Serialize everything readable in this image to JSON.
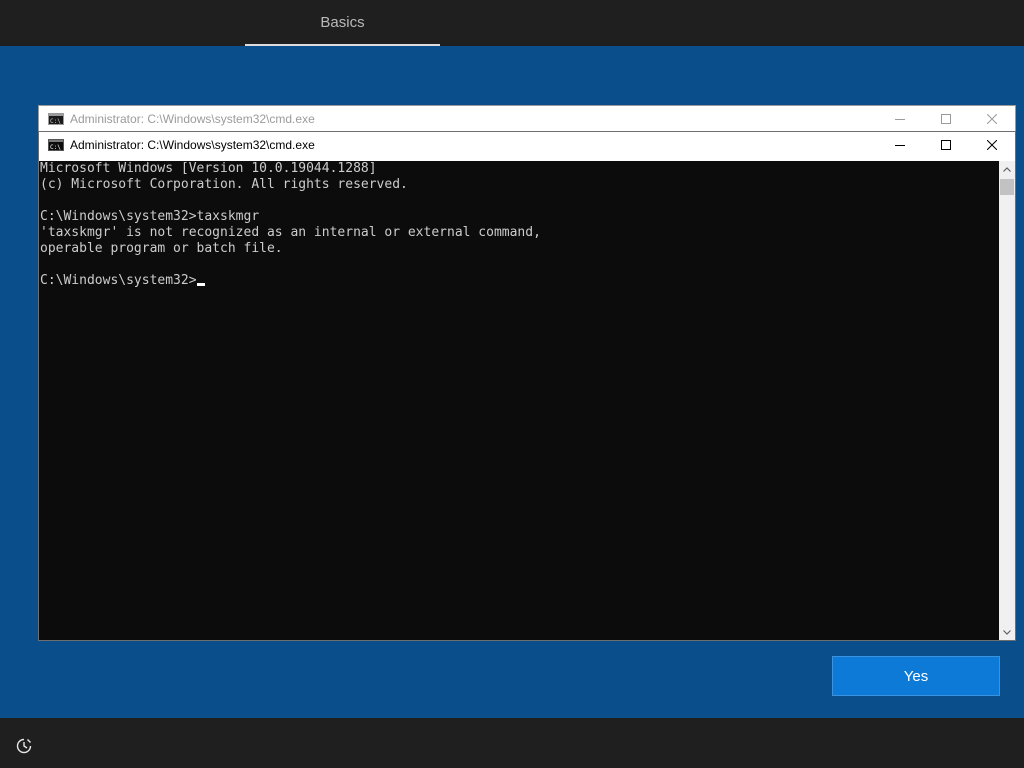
{
  "oobe": {
    "step_tab": "Basics",
    "yes_label": "Yes"
  },
  "background_window": {
    "title": "Administrator: C:\\Windows\\system32\\cmd.exe"
  },
  "console_window": {
    "title": "Administrator: C:\\Windows\\system32\\cmd.exe",
    "lines": [
      "Microsoft Windows [Version 10.0.19044.1288]",
      "(c) Microsoft Corporation. All rights reserved.",
      "",
      "C:\\Windows\\system32>taxskmgr",
      "'taxskmgr' is not recognized as an internal or external command,",
      "operable program or batch file.",
      "",
      "C:\\Windows\\system32>"
    ]
  },
  "icons": {
    "window_icon": "console-icon",
    "minimize": "minimize-icon",
    "maximize": "maximize-icon",
    "close": "close-icon",
    "accessibility": "accessibility-icon"
  },
  "colors": {
    "desktop_bg": "#0a4e8c",
    "bar_bg": "#1f1f1f",
    "accent_button": "#0c7ad6",
    "console_bg": "#0c0c0c",
    "console_text": "#cccccc"
  }
}
